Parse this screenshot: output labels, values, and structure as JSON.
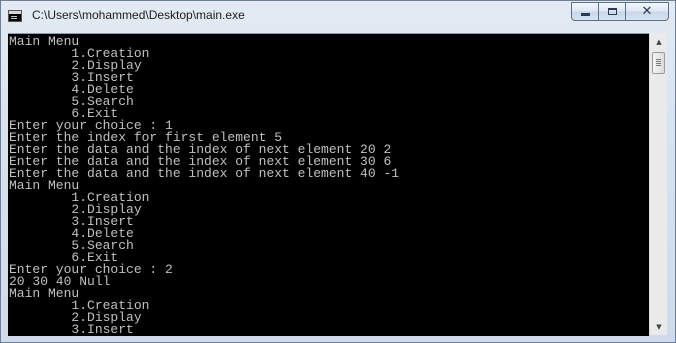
{
  "window": {
    "title": "C:\\Users\\mohammed\\Desktop\\main.exe",
    "icon": "console-app-icon",
    "controls": {
      "minimize_icon": "minimize-icon",
      "maximize_icon": "maximize-icon",
      "close_glyph": "✕"
    }
  },
  "console": {
    "text_color": "#c0c0c0",
    "background": "#000000",
    "lines": [
      "Main Menu",
      "        1.Creation",
      "        2.Display",
      "        3.Insert",
      "        4.Delete",
      "        5.Search",
      "        6.Exit",
      "Enter your choice : 1",
      "Enter the index for first element 5",
      "Enter the data and the index of next element 20 2",
      "Enter the data and the index of next element 30 6",
      "Enter the data and the index of next element 40 -1",
      "Main Menu",
      "        1.Creation",
      "        2.Display",
      "        3.Insert",
      "        4.Delete",
      "        5.Search",
      "        6.Exit",
      "Enter your choice : 2",
      "20 30 40 Null",
      "Main Menu",
      "        1.Creation",
      "        2.Display",
      "        3.Insert"
    ]
  },
  "scrollbar": {
    "up_glyph": "▲",
    "down_glyph": "▼"
  }
}
